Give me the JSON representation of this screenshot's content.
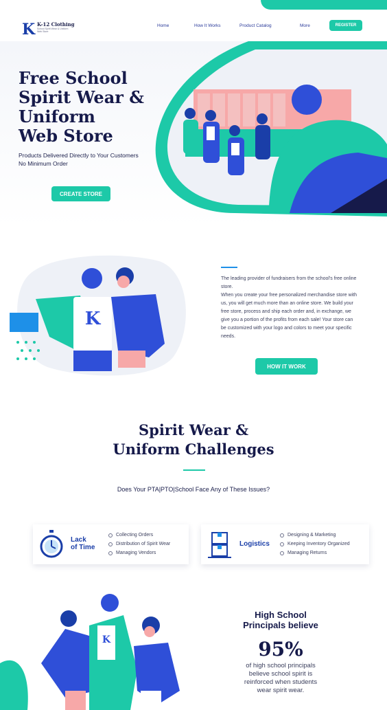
{
  "header": {
    "logo_letter": "K",
    "logo_name": "K-12 Clothing",
    "logo_tagline": "School Spirit Wear & Uniform Web Store",
    "nav": [
      {
        "label": "Home"
      },
      {
        "label": "How It Works"
      },
      {
        "label": "Product Catalog"
      },
      {
        "label": "More"
      }
    ],
    "register_label": "REGISTER"
  },
  "hero": {
    "title_lines": [
      "Free School",
      "Spirit Wear &",
      "Uniform",
      "Web Store"
    ],
    "subtitle_lines": [
      "Products Delivered Directly to Your Customers",
      "No Minimum Order"
    ],
    "cta_label": "CREATE STORE"
  },
  "about": {
    "paragraph_1": "The leading provider of fundraisers from the school's free online store.",
    "paragraph_2": "When you create your free personalized merchandise store with us, you will get much more than an online store. We build your free store, process and ship each order and, in exchange, we give you a portion of the profits from each sale! Your store can be customized with your logo and colors to meet your specific needs.",
    "cta_label": "HOW IT WORK"
  },
  "challenges": {
    "title_lines": [
      "Spirit Wear &",
      "Uniform Challenges"
    ],
    "question": "Does Your PTA|PTO|School Face Any of These Issues?",
    "cards": [
      {
        "icon": "stopwatch-icon",
        "title_lines": [
          "Lack",
          "of Time"
        ],
        "items": [
          "Collecting Orders",
          "Distribution of Spirit Wear",
          "Managing Vendors"
        ]
      },
      {
        "icon": "boxes-icon",
        "title_lines": [
          "Logistics"
        ],
        "items": [
          "Designing & Marketing",
          "Keeping Inventory Organized",
          "Managing Returns"
        ]
      }
    ]
  },
  "principals": {
    "title_lines": [
      "High School",
      "Principals believe"
    ],
    "percent": "95%",
    "text_lines": [
      "of high school principals",
      "believe school spirit is",
      "reinforced when students",
      "wear spirit wear."
    ]
  },
  "colors": {
    "accent_teal": "#1dc9a8",
    "brand_blue": "#1a3ea8",
    "navy_text": "#161a4a",
    "sky_blue": "#1e90e8"
  }
}
